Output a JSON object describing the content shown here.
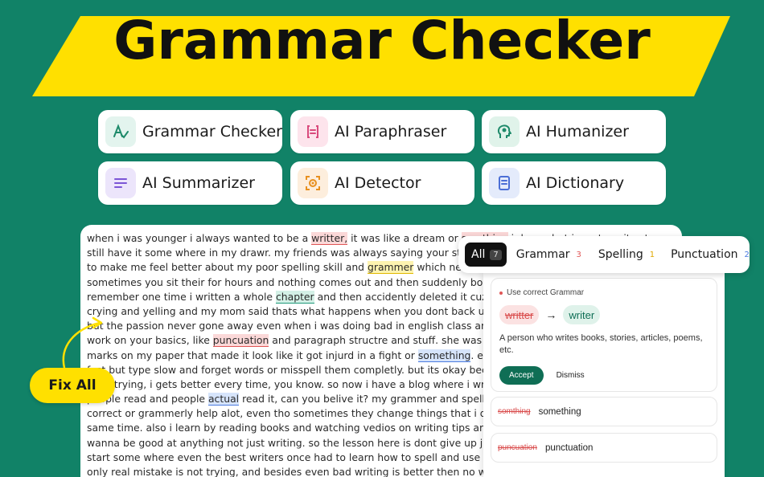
{
  "banner": {
    "title": "Grammar Checker"
  },
  "tools": [
    {
      "label": "Grammar Checker",
      "icon": "grammar-check-icon",
      "bg": "#e3f4ee",
      "fg": "#1e8a6a"
    },
    {
      "label": "AI Paraphraser",
      "icon": "paraphrase-icon",
      "bg": "#fde4ec",
      "fg": "#d94b7d"
    },
    {
      "label": "AI Humanizer",
      "icon": "humanizer-icon",
      "bg": "#e0f3ea",
      "fg": "#1e8a6a"
    },
    {
      "label": "AI Summarizer",
      "icon": "summarize-icon",
      "bg": "#ece5fb",
      "fg": "#7b55d6"
    },
    {
      "label": "AI Detector",
      "icon": "detector-icon",
      "bg": "#fdeedd",
      "fg": "#e8901f"
    },
    {
      "label": "AI Dictionary",
      "icon": "dictionary-icon",
      "bg": "#e4ebfb",
      "fg": "#4b6fd6"
    }
  ],
  "document": {
    "lines": [
      [
        [
          "when i was younger i always wanted to be a ",
          ""
        ],
        [
          "writter,",
          "red"
        ],
        [
          " it was like a dream or ",
          ""
        ],
        [
          "somthing",
          "red"
        ],
        [
          " i dunno but i use to write stor as on my note books which i",
          ""
        ]
      ],
      [
        [
          "still have it some where in my drawr. my friends was always saying your storys are weird but",
          ""
        ]
      ],
      [
        [
          "to make me feel better about my poor spelling skill and ",
          ""
        ],
        [
          "grammer",
          "yellow"
        ],
        [
          " which never was great",
          ""
        ]
      ],
      [
        [
          "sometimes you sit their for hours and nothing comes out and then suddenly boom you wrote T",
          ""
        ]
      ],
      [
        [
          "remember one time i written a whole ",
          ""
        ],
        [
          "chapter",
          "teal"
        ],
        [
          " and then accidently deleted it cuz i didnt save an",
          ""
        ]
      ],
      [
        [
          "crying and yelling and my mom said thats what happens when you dont back up your work wh",
          ""
        ]
      ],
      [
        [
          "but the passion never gone away even when i was doing bad in english class and my teacher t",
          ""
        ]
      ],
      [
        [
          "work on your basics, like ",
          ""
        ],
        [
          "puncuation",
          "red"
        ],
        [
          " and paragraph structre and stuff. she was a nice teacher",
          ""
        ]
      ],
      [
        [
          "marks on my paper that made it look like it got injurd in a fight or ",
          ""
        ],
        [
          "something",
          "blue"
        ],
        [
          ". even now, i still m",
          ""
        ]
      ],
      [
        [
          "fast but type slow and forget words or misspell them completly. but its okay becuz nobodys pe",
          ""
        ]
      ],
      [
        [
          "keep trying, i gets better every time, you know. so now i have a blog where i writes storys and",
          ""
        ]
      ],
      [
        [
          "people read and people ",
          ""
        ],
        [
          "actual",
          "blue"
        ],
        [
          " read it, can you belive it? my grammer and spelling is still not perfec",
          ""
        ]
      ],
      [
        [
          "correct or grammerly help alot, even tho sometimes they change things that i didnt mean to c",
          ""
        ]
      ],
      [
        [
          "same time. also i learn by reading books and watching vedios on writing tips and stuff like that,",
          ""
        ]
      ],
      [
        [
          "wanna be good at anything not just writing. so the lesson here is dont give up just cuz your bad",
          ""
        ]
      ],
      [
        [
          "start some where even the best writers once had to learn how to spell and use comas properl",
          ""
        ]
      ],
      [
        [
          "only real mistake is not trying, and besides even bad writing is better then no writing at all caus",
          ""
        ]
      ]
    ]
  },
  "fix_all": {
    "label": "Fix All"
  },
  "filters": {
    "all": {
      "label": "All",
      "count": "7"
    },
    "grammar": {
      "label": "Grammar",
      "count": "3",
      "color": "#e05656"
    },
    "spelling": {
      "label": "Spelling",
      "count": "1",
      "color": "#e0a800"
    },
    "punctuation": {
      "label": "Punctuation",
      "count": "2",
      "color": "#4b7be0"
    }
  },
  "suggestions": {
    "main": {
      "category": "Use correct Grammar",
      "original": "writter",
      "replacement": "writer",
      "arrow": "→",
      "description": "A person who writes books, stories, articles, poems, etc.",
      "accept_label": "Accept",
      "dismiss_label": "Dismiss"
    },
    "others": [
      {
        "original": "somthing",
        "replacement": "something"
      },
      {
        "original": "puncuation",
        "replacement": "punctuation"
      }
    ]
  }
}
